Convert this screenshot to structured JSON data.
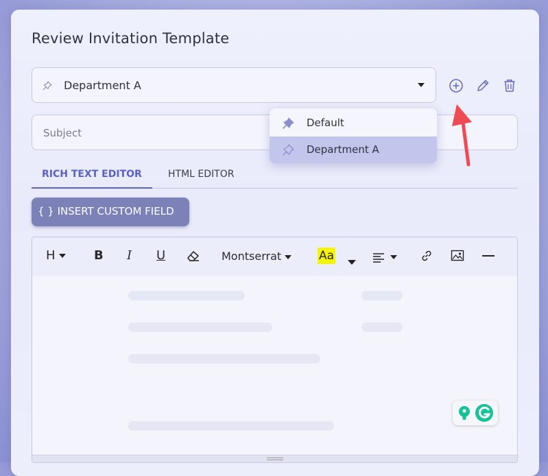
{
  "dialog": {
    "title": "Review Invitation Template"
  },
  "template_select": {
    "value": "Department A",
    "icons": [
      "pin-outline-icon",
      "caret-down-icon"
    ]
  },
  "template_actions": {
    "add_icon": "add-circle-icon",
    "edit_icon": "pencil-icon",
    "delete_icon": "trash-icon"
  },
  "dropdown": {
    "items": [
      {
        "label": "Default",
        "icon": "pin-filled-icon",
        "selected": false
      },
      {
        "label": "Department A",
        "icon": "pin-outline-icon",
        "selected": true
      }
    ]
  },
  "subject": {
    "placeholder": "Subject",
    "value": ""
  },
  "tabs": [
    {
      "label": "RICH TEXT EDITOR",
      "active": true
    },
    {
      "label": "HTML EDITOR",
      "active": false
    }
  ],
  "insert_button": {
    "label": "{ } INSERT CUSTOM FIELD"
  },
  "toolbar": {
    "heading": "H",
    "bold": "B",
    "italic": "I",
    "underline": "U",
    "font": "Montserrat",
    "text_color_label": "Aa",
    "highlight_color": "#f5f500"
  },
  "colors": {
    "accent": "#5a60c8",
    "button": "#7c82b8",
    "selected_item": "#c3c6ec",
    "annotation_arrow": "#f04a55"
  }
}
